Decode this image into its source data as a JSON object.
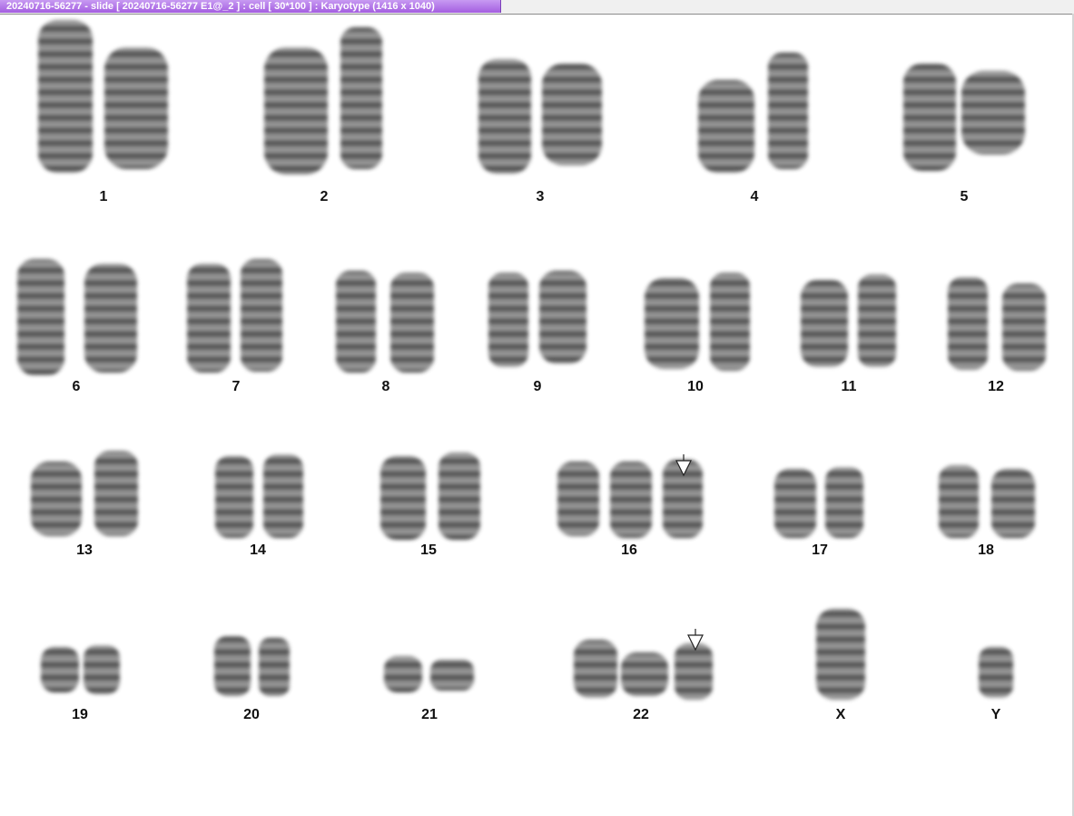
{
  "window": {
    "title": "20240716-56277 - slide [ 20240716-56277 E1@_2 ] : cell [ 30*100 ] : Karyotype  (1416 x 1040)"
  },
  "karyotype": {
    "labels": [
      "1",
      "2",
      "3",
      "4",
      "5",
      "6",
      "7",
      "8",
      "9",
      "10",
      "11",
      "12",
      "13",
      "14",
      "15",
      "16",
      "17",
      "18",
      "19",
      "20",
      "21",
      "22",
      "X",
      "Y"
    ],
    "abnormal_marker_icon": "down-arrow-outline-icon",
    "abnormal_markers": [
      "16",
      "22"
    ]
  },
  "colors": {
    "title_bar_accent": "#b074ea",
    "chromosome": "#3a3a3a"
  }
}
